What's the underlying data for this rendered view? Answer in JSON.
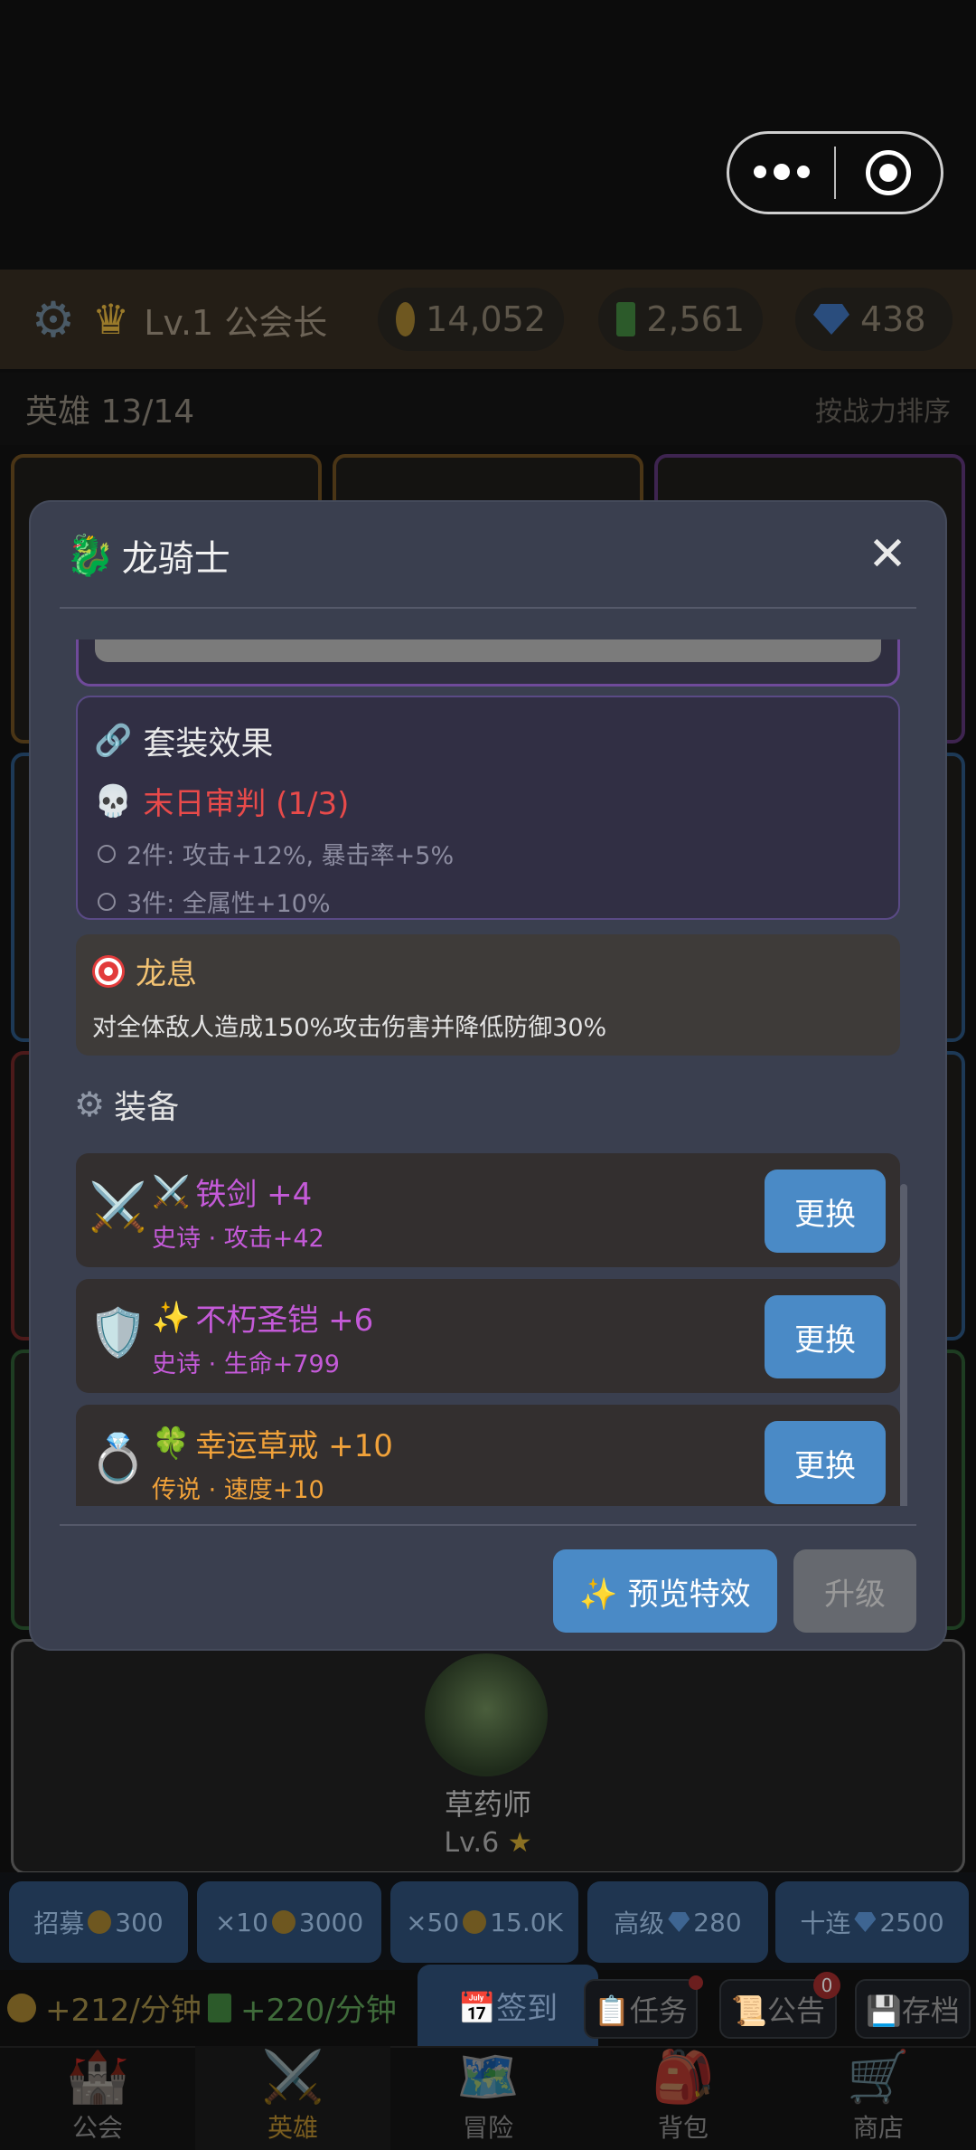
{
  "capsule": {
    "more_icon": "more-dots-icon",
    "close_icon": "target-close-icon"
  },
  "topbar": {
    "level": "Lv.1 公会长",
    "gold": "14,052",
    "books": "2,561",
    "gems": "438"
  },
  "heroes": {
    "count": "英雄 13/14",
    "sort": "按战力排序"
  },
  "herb_card": {
    "name": "草药师",
    "level": "Lv.6",
    "star": "★"
  },
  "recruit": [
    {
      "label": "招募",
      "cost": "300",
      "currency": "coin"
    },
    {
      "label": "×10",
      "cost": "3000",
      "currency": "coin"
    },
    {
      "label": "×50",
      "cost": "15.0K",
      "currency": "coin"
    },
    {
      "label": "高级",
      "cost": "280",
      "currency": "gem"
    },
    {
      "label": "十连",
      "cost": "2500",
      "currency": "gem"
    }
  ],
  "income": {
    "gold_rate": "+212/分钟",
    "book_rate": "+220/分钟"
  },
  "actions": {
    "checkin": "📅签到",
    "tasks": "📋任务",
    "notice": "📜公告",
    "notice_badge": "0",
    "save": "💾存档"
  },
  "tabs": [
    {
      "icon": "🏰",
      "label": "公会"
    },
    {
      "icon": "⚔️",
      "label": "英雄"
    },
    {
      "icon": "🗺️",
      "label": "冒险"
    },
    {
      "icon": "🎒",
      "label": "背包"
    },
    {
      "icon": "🛒",
      "label": "商店"
    }
  ],
  "modal": {
    "icon": "🐉",
    "title": "龙骑士",
    "close": "✕",
    "set": {
      "title": "套装效果",
      "name": "末日审判 (1/3)",
      "items": [
        "2件: 攻击+12%, 暴击率+5%",
        "3件: 全属性+10%"
      ]
    },
    "skill": {
      "name": "龙息",
      "desc": "对全体敌人造成150%攻击伤害并降低防御30%"
    },
    "equip_title": "装备",
    "equipment": [
      {
        "icon": "⚔️",
        "prefix": "⚔️",
        "name": "铁剑 +4",
        "rarity": "史诗",
        "stat": "攻击+42",
        "button": "更换",
        "color": "#c45ad8"
      },
      {
        "icon": "🛡️",
        "prefix": "✨",
        "name": "不朽圣铠 +6",
        "rarity": "史诗",
        "stat": "生命+799",
        "button": "更换",
        "color": "#c45ad8"
      },
      {
        "icon": "💍",
        "prefix": "🍀",
        "name": "幸运草戒 +10",
        "rarity": "传说",
        "stat": "速度+10",
        "button": "更换",
        "color": "#f1a23a"
      }
    ],
    "preview_button": "✨ 预览特效",
    "upgrade_button": "升级"
  }
}
